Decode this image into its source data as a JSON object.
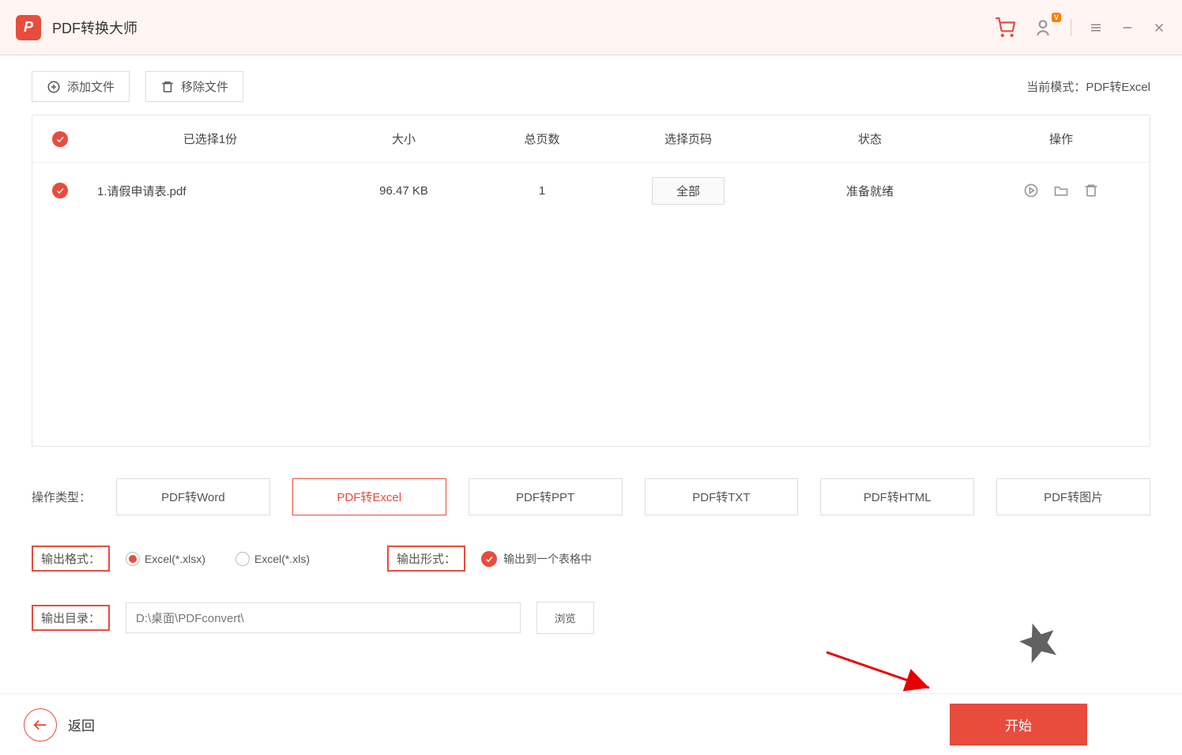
{
  "app": {
    "title": "PDF转换大师"
  },
  "toolbar": {
    "add_label": "添加文件",
    "remove_label": "移除文件",
    "mode_prefix": "当前模式：",
    "mode_value": "PDF转Excel"
  },
  "table": {
    "headers": {
      "selected": "已选择1份",
      "size": "大小",
      "pages": "总页数",
      "select_pages": "选择页码",
      "status": "状态",
      "ops": "操作"
    },
    "rows": [
      {
        "name": "1.请假申请表.pdf",
        "size": "96.47 KB",
        "pages": "1",
        "select_pages": "全部",
        "status": "准备就绪"
      }
    ]
  },
  "ops_type": {
    "label": "操作类型：",
    "options": [
      "PDF转Word",
      "PDF转Excel",
      "PDF转PPT",
      "PDF转TXT",
      "PDF转HTML",
      "PDF转图片"
    ],
    "active_index": 1
  },
  "output_format": {
    "label": "输出格式：",
    "options": [
      "Excel(*.xlsx)",
      "Excel(*.xls)"
    ],
    "selected_index": 0
  },
  "output_form": {
    "label": "输出形式：",
    "option": "输出到一个表格中"
  },
  "output_dir": {
    "label": "输出目录：",
    "value": "D:\\桌面\\PDFconvert\\",
    "browse": "浏览"
  },
  "footer": {
    "back": "返回",
    "start": "开始"
  }
}
